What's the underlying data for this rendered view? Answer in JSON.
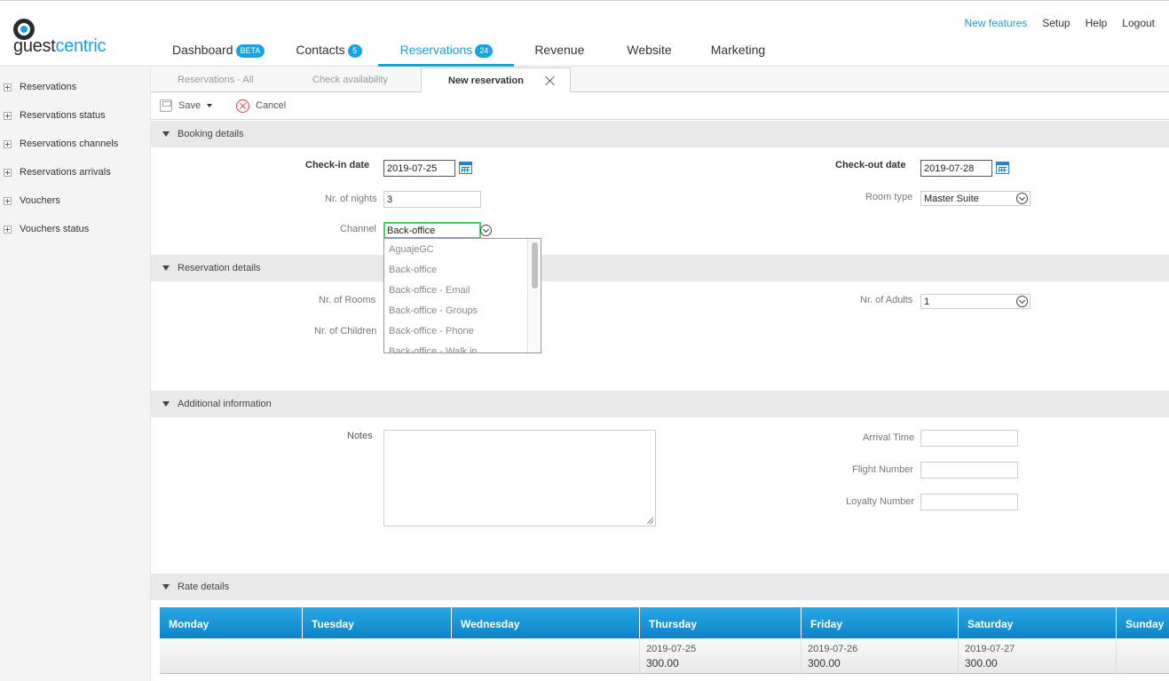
{
  "logo": {
    "text_a": "guest",
    "text_b": "centric"
  },
  "util_nav": [
    "New features",
    "Setup",
    "Help",
    "Logout"
  ],
  "main_nav": [
    {
      "label": "Dashboard",
      "badge": "BETA"
    },
    {
      "label": "Contacts",
      "badge": "5"
    },
    {
      "label": "Reservations",
      "badge": "24"
    },
    {
      "label": "Revenue",
      "badge": ""
    },
    {
      "label": "Website",
      "badge": ""
    },
    {
      "label": "Marketing",
      "badge": ""
    }
  ],
  "sidebar": {
    "items": [
      {
        "label": "Reservations"
      },
      {
        "label": "Reservations status"
      },
      {
        "label": "Reservations channels"
      },
      {
        "label": "Reservations arrivals"
      },
      {
        "label": "Vouchers"
      },
      {
        "label": "Vouchers status"
      }
    ]
  },
  "subtabs": [
    "Reservations - All",
    "Check availability",
    "New reservation"
  ],
  "toolbar": {
    "save_label": "Save",
    "cancel_label": "Cancel"
  },
  "sections": {
    "booking": "Booking details",
    "reservation": "Reservation details",
    "additional": "Additional information",
    "rate": "Rate details"
  },
  "booking": {
    "checkin_label": "Check-in date",
    "checkin_value": "2019-07-25",
    "checkout_label": "Check-out date",
    "checkout_value": "2019-07-28",
    "nights_label": "Nr. of nights",
    "nights_value": "3",
    "room_type_label": "Room type",
    "room_type_value": "Master Suite",
    "channel_label": "Channel",
    "channel_value": "Back-office"
  },
  "channel_options": [
    "AguajeGC",
    "Back-office",
    "Back-office - Email",
    "Back-office - Groups",
    "Back-office - Phone",
    "Back-office - Walk in"
  ],
  "reservation": {
    "rooms_label": "Nr. of Rooms",
    "children_label": "Nr. of Children",
    "adults_label": "Nr. of Adults",
    "adults_value": "1"
  },
  "additional": {
    "notes_label": "Notes",
    "arrival_label": "Arrival Time",
    "flight_label": "Flight Number",
    "loyalty_label": "Loyalty Number"
  },
  "rate": {
    "days": [
      "Monday",
      "Tuesday",
      "Wednesday",
      "Thursday",
      "Friday",
      "Saturday",
      "Sunday"
    ],
    "cells": [
      {
        "date": "",
        "price": ""
      },
      {
        "date": "",
        "price": ""
      },
      {
        "date": "",
        "price": ""
      },
      {
        "date": "2019-07-25",
        "price": "300.00"
      },
      {
        "date": "2019-07-26",
        "price": "300.00"
      },
      {
        "date": "2019-07-27",
        "price": "300.00"
      },
      {
        "date": "",
        "price": ""
      }
    ]
  },
  "colors": {
    "accent": "#1a9fd8",
    "focus": "#4cc96b",
    "cancel": "#e04040"
  }
}
